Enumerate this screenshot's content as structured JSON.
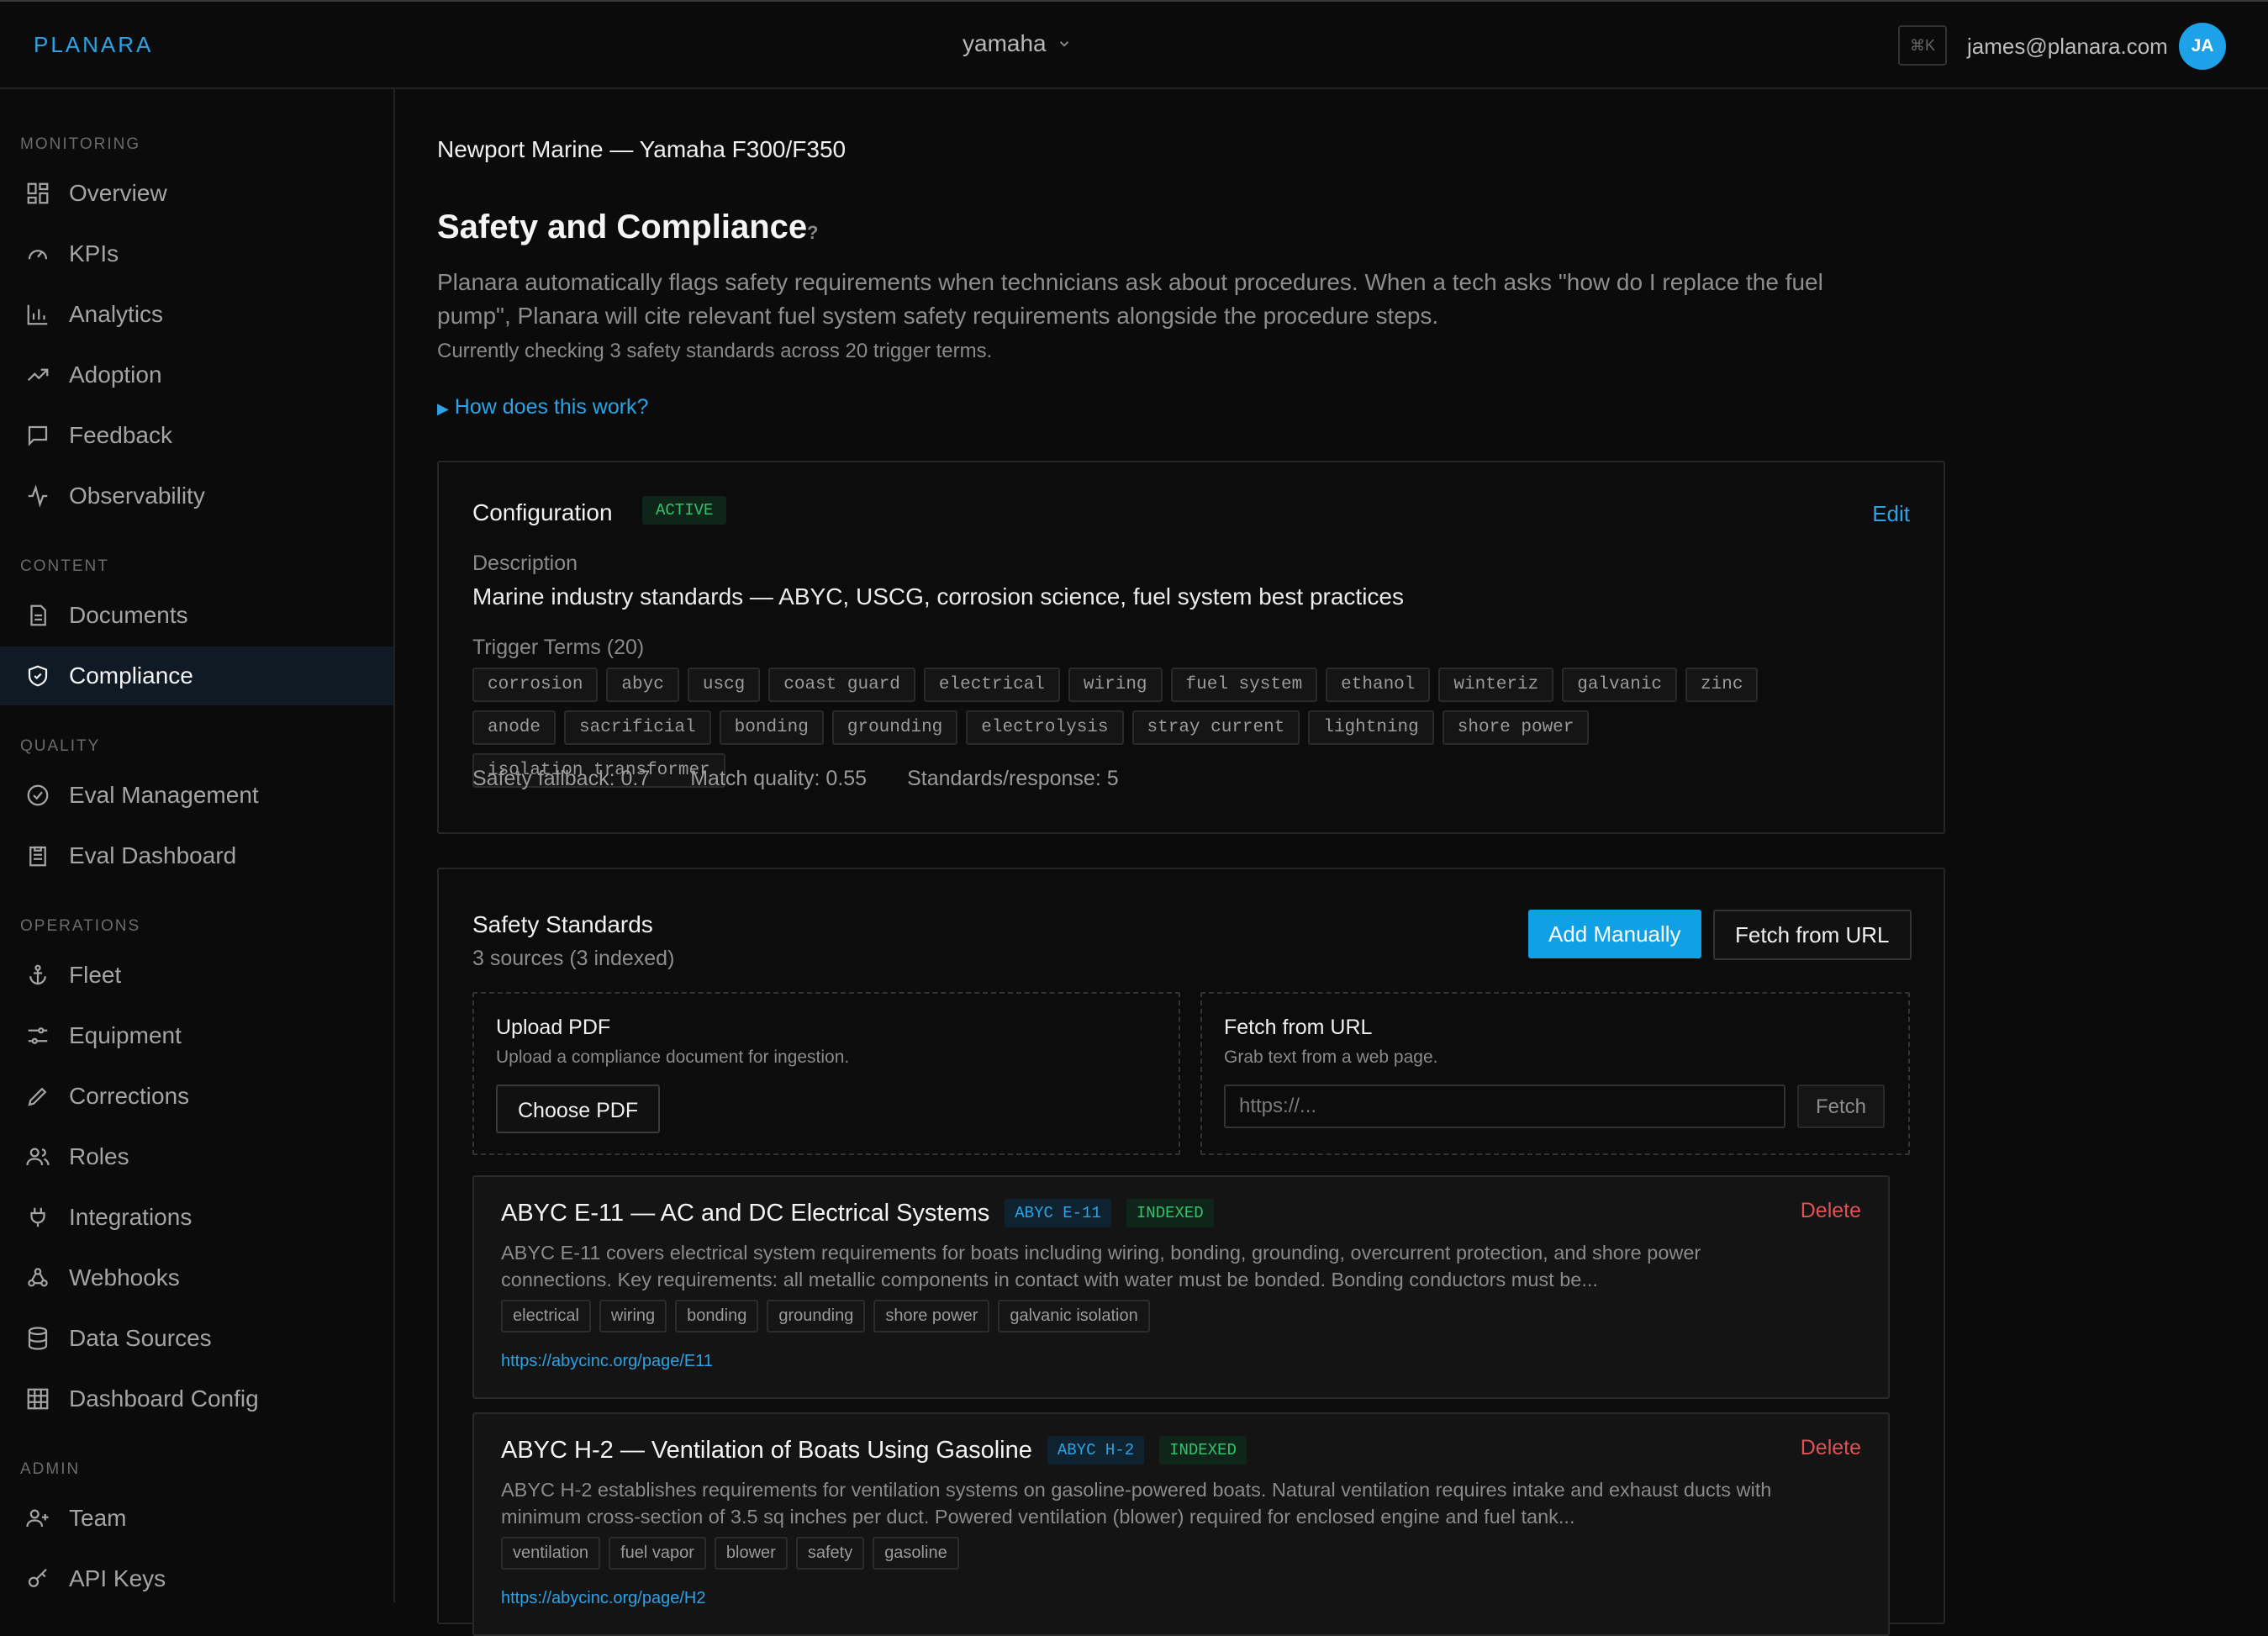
{
  "header": {
    "logo": "PLANARA",
    "org": "yamaha",
    "shortcut": "⌘K",
    "user_email": "james@planara.com",
    "avatar_initials": "JA"
  },
  "sidebar": {
    "sections": [
      {
        "label": "MONITORING",
        "items": [
          {
            "label": "Overview",
            "icon": "grid-icon"
          },
          {
            "label": "KPIs",
            "icon": "gauge-icon"
          },
          {
            "label": "Analytics",
            "icon": "bar-chart-icon"
          },
          {
            "label": "Adoption",
            "icon": "trend-up-icon"
          },
          {
            "label": "Feedback",
            "icon": "message-icon"
          },
          {
            "label": "Observability",
            "icon": "activity-icon"
          }
        ]
      },
      {
        "label": "CONTENT",
        "items": [
          {
            "label": "Documents",
            "icon": "document-icon"
          },
          {
            "label": "Compliance",
            "icon": "shield-check-icon",
            "active": true
          }
        ]
      },
      {
        "label": "QUALITY",
        "items": [
          {
            "label": "Eval Management",
            "icon": "check-circle-icon"
          },
          {
            "label": "Eval Dashboard",
            "icon": "clipboard-icon"
          }
        ]
      },
      {
        "label": "OPERATIONS",
        "items": [
          {
            "label": "Fleet",
            "icon": "anchor-icon"
          },
          {
            "label": "Equipment",
            "icon": "sliders-icon"
          },
          {
            "label": "Corrections",
            "icon": "pencil-icon"
          },
          {
            "label": "Roles",
            "icon": "users-icon"
          },
          {
            "label": "Integrations",
            "icon": "plug-icon"
          },
          {
            "label": "Webhooks",
            "icon": "webhook-icon"
          },
          {
            "label": "Data Sources",
            "icon": "database-icon"
          },
          {
            "label": "Dashboard Config",
            "icon": "table-icon"
          }
        ]
      },
      {
        "label": "ADMIN",
        "items": [
          {
            "label": "Team",
            "icon": "user-plus-icon"
          },
          {
            "label": "API Keys",
            "icon": "key-icon"
          }
        ]
      }
    ]
  },
  "page": {
    "breadcrumb": "Newport Marine — Yamaha F300/F350",
    "title": "Safety and Compliance",
    "help": "?",
    "intro": "Planara automatically flags safety requirements when technicians ask about procedures. When a tech asks \"how do I replace the fuel pump\", Planara will cite relevant fuel system safety requirements alongside the procedure steps.",
    "status_line": "Currently checking 3 safety standards across 20 trigger terms.",
    "how_link": "How does this work?"
  },
  "config": {
    "title": "Configuration",
    "status": "ACTIVE",
    "edit_label": "Edit",
    "description_label": "Description",
    "description": "Marine industry standards — ABYC, USCG, corrosion science, fuel system best practices",
    "trigger_label": "Trigger Terms (20)",
    "terms": [
      "corrosion",
      "abyc",
      "uscg",
      "coast guard",
      "electrical",
      "wiring",
      "fuel system",
      "ethanol",
      "winteriz",
      "galvanic",
      "zinc",
      "anode",
      "sacrificial",
      "bonding",
      "grounding",
      "electrolysis",
      "stray current",
      "lightning",
      "shore power",
      "isolation transformer"
    ],
    "metrics": [
      "Safety fallback: 0.7",
      "Match quality: 0.55",
      "Standards/response: 5"
    ]
  },
  "standards": {
    "title": "Safety Standards",
    "subtitle": "3 sources (3 indexed)",
    "add_manual": "Add Manually",
    "fetch_url": "Fetch from URL",
    "upload": {
      "title": "Upload PDF",
      "sub": "Upload a compliance document for ingestion.",
      "button": "Choose PDF"
    },
    "fetch": {
      "title": "Fetch from URL",
      "sub": "Grab text from a web page.",
      "placeholder": "https://...",
      "button": "Fetch"
    },
    "items": [
      {
        "title": "ABYC E-11 — AC and DC Electrical Systems",
        "code": "ABYC E-11",
        "status": "INDEXED",
        "delete": "Delete",
        "desc": "ABYC E-11 covers electrical system requirements for boats including wiring, bonding, grounding, overcurrent protection, and shore power connections. Key requirements: all metallic components in contact with water must be bonded. Bonding conductors must be...",
        "tags": [
          "electrical",
          "wiring",
          "bonding",
          "grounding",
          "shore power",
          "galvanic isolation"
        ],
        "url": "https://abycinc.org/page/E11"
      },
      {
        "title": "ABYC H-2 — Ventilation of Boats Using Gasoline",
        "code": "ABYC H-2",
        "status": "INDEXED",
        "delete": "Delete",
        "desc": "ABYC H-2 establishes requirements for ventilation systems on gasoline-powered boats. Natural ventilation requires intake and exhaust ducts with minimum cross-section of 3.5 sq inches per duct. Powered ventilation (blower) required for enclosed engine and fuel tank...",
        "tags": [
          "ventilation",
          "fuel vapor",
          "blower",
          "safety",
          "gasoline"
        ],
        "url": "https://abycinc.org/page/H2"
      }
    ]
  }
}
